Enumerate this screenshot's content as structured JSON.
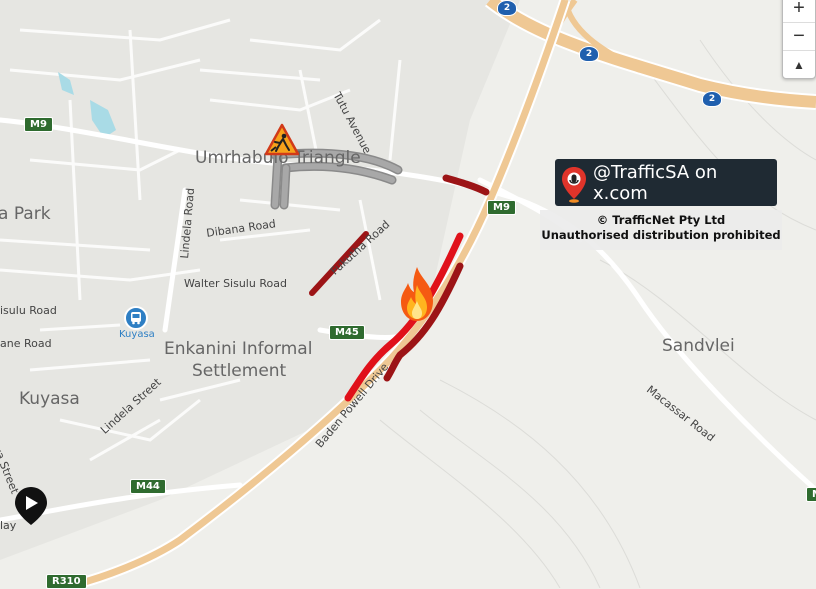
{
  "map": {
    "areas": {
      "umrhabulo": "Umrhabulo Triangle",
      "park": "a Park",
      "kuyasa": "Kuyasa",
      "enkanini_1": "Enkanini Informal",
      "enkanini_2": "Settlement",
      "sandvlei": "Sandvlei"
    },
    "streets": {
      "tutu": "Tutu Avenue",
      "lindela_road": "Lindela Road",
      "dibana": "Dibana Road",
      "fukutha": "Fukutha Road",
      "walter_sisulu": "Walter Sisulu Road",
      "sisulu_left": "isulu Road",
      "lane_left": "ane Road",
      "lindela_street": "Lindela Street",
      "kuyasa_poi": "Kuyasa",
      "baden_powell": "Baden Powell Drive",
      "macassar": "Macassar Road",
      "street_left": "aya Street",
      "way_left": "lay"
    },
    "shields": {
      "m9_left": "M9",
      "m9_right": "M9",
      "m45": "M45",
      "m44": "M44",
      "r310": "R310",
      "m_right": "M",
      "n2_a": "2",
      "n2_b": "2",
      "n2_c": "2"
    }
  },
  "controls": {
    "zoom_in": "+",
    "zoom_out": "−",
    "compass": "▲"
  },
  "branding": {
    "handle": "@TrafficSA on x.com",
    "copyright": "© TrafficNet Pty Ltd",
    "notice": "Unauthorised distribution prohibited"
  },
  "incidents": {
    "roadworks": "roadworks-warning-icon",
    "fire": "fire-icon"
  },
  "colors": {
    "water": "#a9dbe6",
    "highway": "#efc894",
    "congestion_red": "#e0111a",
    "congestion_dark": "#9c1416",
    "closure_gray": "#a8a8a8"
  }
}
